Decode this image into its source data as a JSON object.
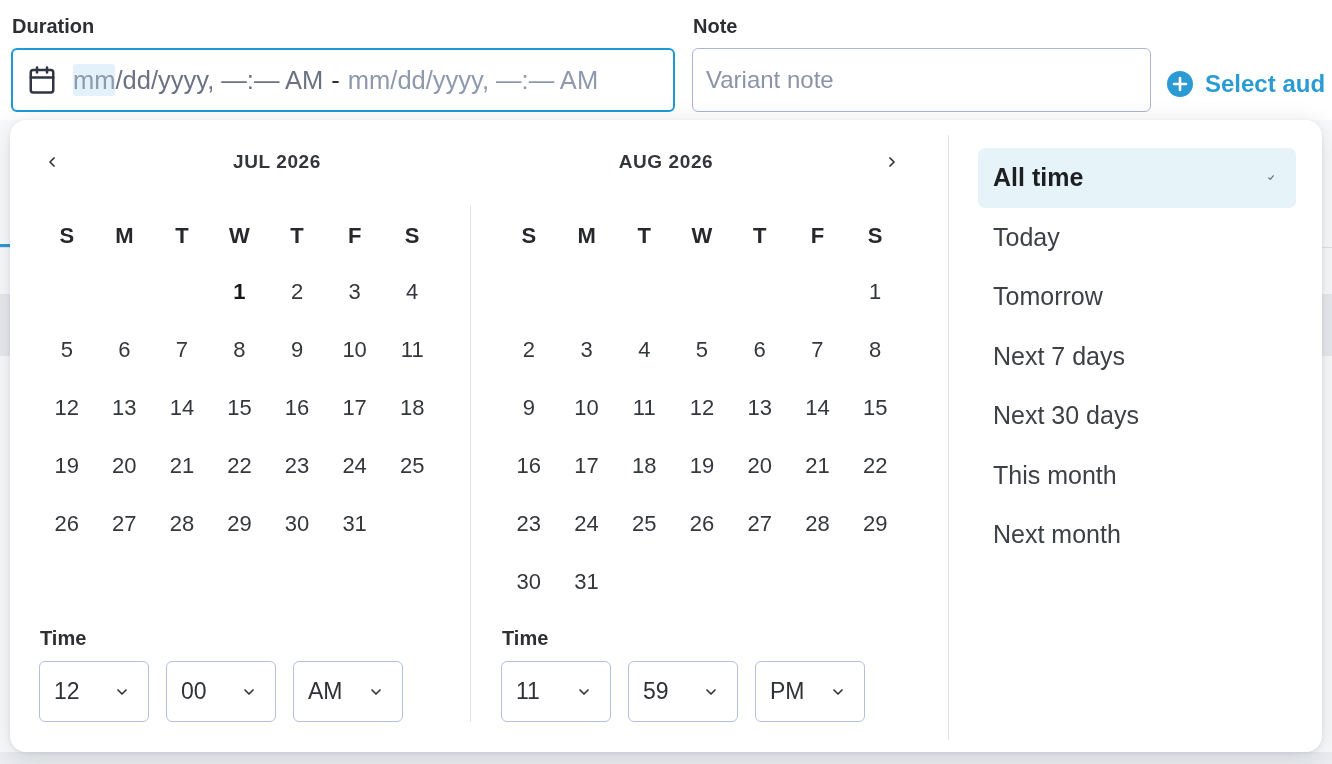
{
  "duration": {
    "label": "Duration",
    "focused": true,
    "start": [
      {
        "text": "mm",
        "selected": true
      },
      {
        "text": "/dd/yyyy, —:— AM",
        "selected": false
      }
    ],
    "separator": "-",
    "end": "mm/dd/yyyy, —:— AM"
  },
  "note": {
    "label": "Note",
    "placeholder": "Variant note"
  },
  "audience_button": {
    "label": "Select aud"
  },
  "date_picker": {
    "months": [
      {
        "title": "JUL 2026",
        "weekdays": [
          "S",
          "M",
          "T",
          "W",
          "T",
          "F",
          "S"
        ],
        "weeks": [
          [
            {
              "label": "1",
              "today": true
            },
            {
              "label": "2",
              "today": false
            },
            {
              "label": "3",
              "today": false
            },
            {
              "label": "4",
              "today": false
            }
          ],
          [
            {
              "label": "5",
              "today": false
            },
            {
              "label": "6",
              "today": false
            },
            {
              "label": "7",
              "today": false
            },
            {
              "label": "8",
              "today": false
            },
            {
              "label": "9",
              "today": false
            },
            {
              "label": "10",
              "today": false
            },
            {
              "label": "11",
              "today": false
            }
          ],
          [
            {
              "label": "12",
              "today": false
            },
            {
              "label": "13",
              "today": false
            },
            {
              "label": "14",
              "today": false
            },
            {
              "label": "15",
              "today": false
            },
            {
              "label": "16",
              "today": false
            },
            {
              "label": "17",
              "today": false
            },
            {
              "label": "18",
              "today": false
            }
          ],
          [
            {
              "label": "19",
              "today": false
            },
            {
              "label": "20",
              "today": false
            },
            {
              "label": "21",
              "today": false
            },
            {
              "label": "22",
              "today": false
            },
            {
              "label": "23",
              "today": false
            },
            {
              "label": "24",
              "today": false
            },
            {
              "label": "25",
              "today": false
            }
          ],
          [
            {
              "label": "26",
              "today": false
            },
            {
              "label": "27",
              "today": false
            },
            {
              "label": "28",
              "today": false
            },
            {
              "label": "29",
              "today": false
            },
            {
              "label": "30",
              "today": false
            },
            {
              "label": "31",
              "today": false
            }
          ]
        ],
        "time": {
          "label": "Time",
          "hour": "12",
          "minute": "00",
          "period": "AM"
        }
      },
      {
        "title": "AUG 2026",
        "weekdays": [
          "S",
          "M",
          "T",
          "W",
          "T",
          "F",
          "S"
        ],
        "weeks": [
          [
            {
              "label": "1",
              "today": false
            }
          ],
          [
            {
              "label": "2",
              "today": false
            },
            {
              "label": "3",
              "today": false
            },
            {
              "label": "4",
              "today": false
            },
            {
              "label": "5",
              "today": false
            },
            {
              "label": "6",
              "today": false
            },
            {
              "label": "7",
              "today": false
            },
            {
              "label": "8",
              "today": false
            }
          ],
          [
            {
              "label": "9",
              "today": false
            },
            {
              "label": "10",
              "today": false
            },
            {
              "label": "11",
              "today": false
            },
            {
              "label": "12",
              "today": false
            },
            {
              "label": "13",
              "today": false
            },
            {
              "label": "14",
              "today": false
            },
            {
              "label": "15",
              "today": false
            }
          ],
          [
            {
              "label": "16",
              "today": false
            },
            {
              "label": "17",
              "today": false
            },
            {
              "label": "18",
              "today": false
            },
            {
              "label": "19",
              "today": false
            },
            {
              "label": "20",
              "today": false
            },
            {
              "label": "21",
              "today": false
            },
            {
              "label": "22",
              "today": false
            }
          ],
          [
            {
              "label": "23",
              "today": false
            },
            {
              "label": "24",
              "today": false
            },
            {
              "label": "25",
              "today": false
            },
            {
              "label": "26",
              "today": false
            },
            {
              "label": "27",
              "today": false
            },
            {
              "label": "28",
              "today": false
            },
            {
              "label": "29",
              "today": false
            }
          ],
          [
            {
              "label": "30",
              "today": false
            },
            {
              "label": "31",
              "today": false
            }
          ]
        ],
        "time": {
          "label": "Time",
          "hour": "11",
          "minute": "59",
          "period": "PM"
        }
      }
    ],
    "presets": [
      {
        "label": "All time",
        "selected": true
      },
      {
        "label": "Today",
        "selected": false
      },
      {
        "label": "Tomorrow",
        "selected": false
      },
      {
        "label": "Next 7 days",
        "selected": false
      },
      {
        "label": "Next 30 days",
        "selected": false
      },
      {
        "label": "This month",
        "selected": false
      },
      {
        "label": "Next month",
        "selected": false
      }
    ]
  }
}
